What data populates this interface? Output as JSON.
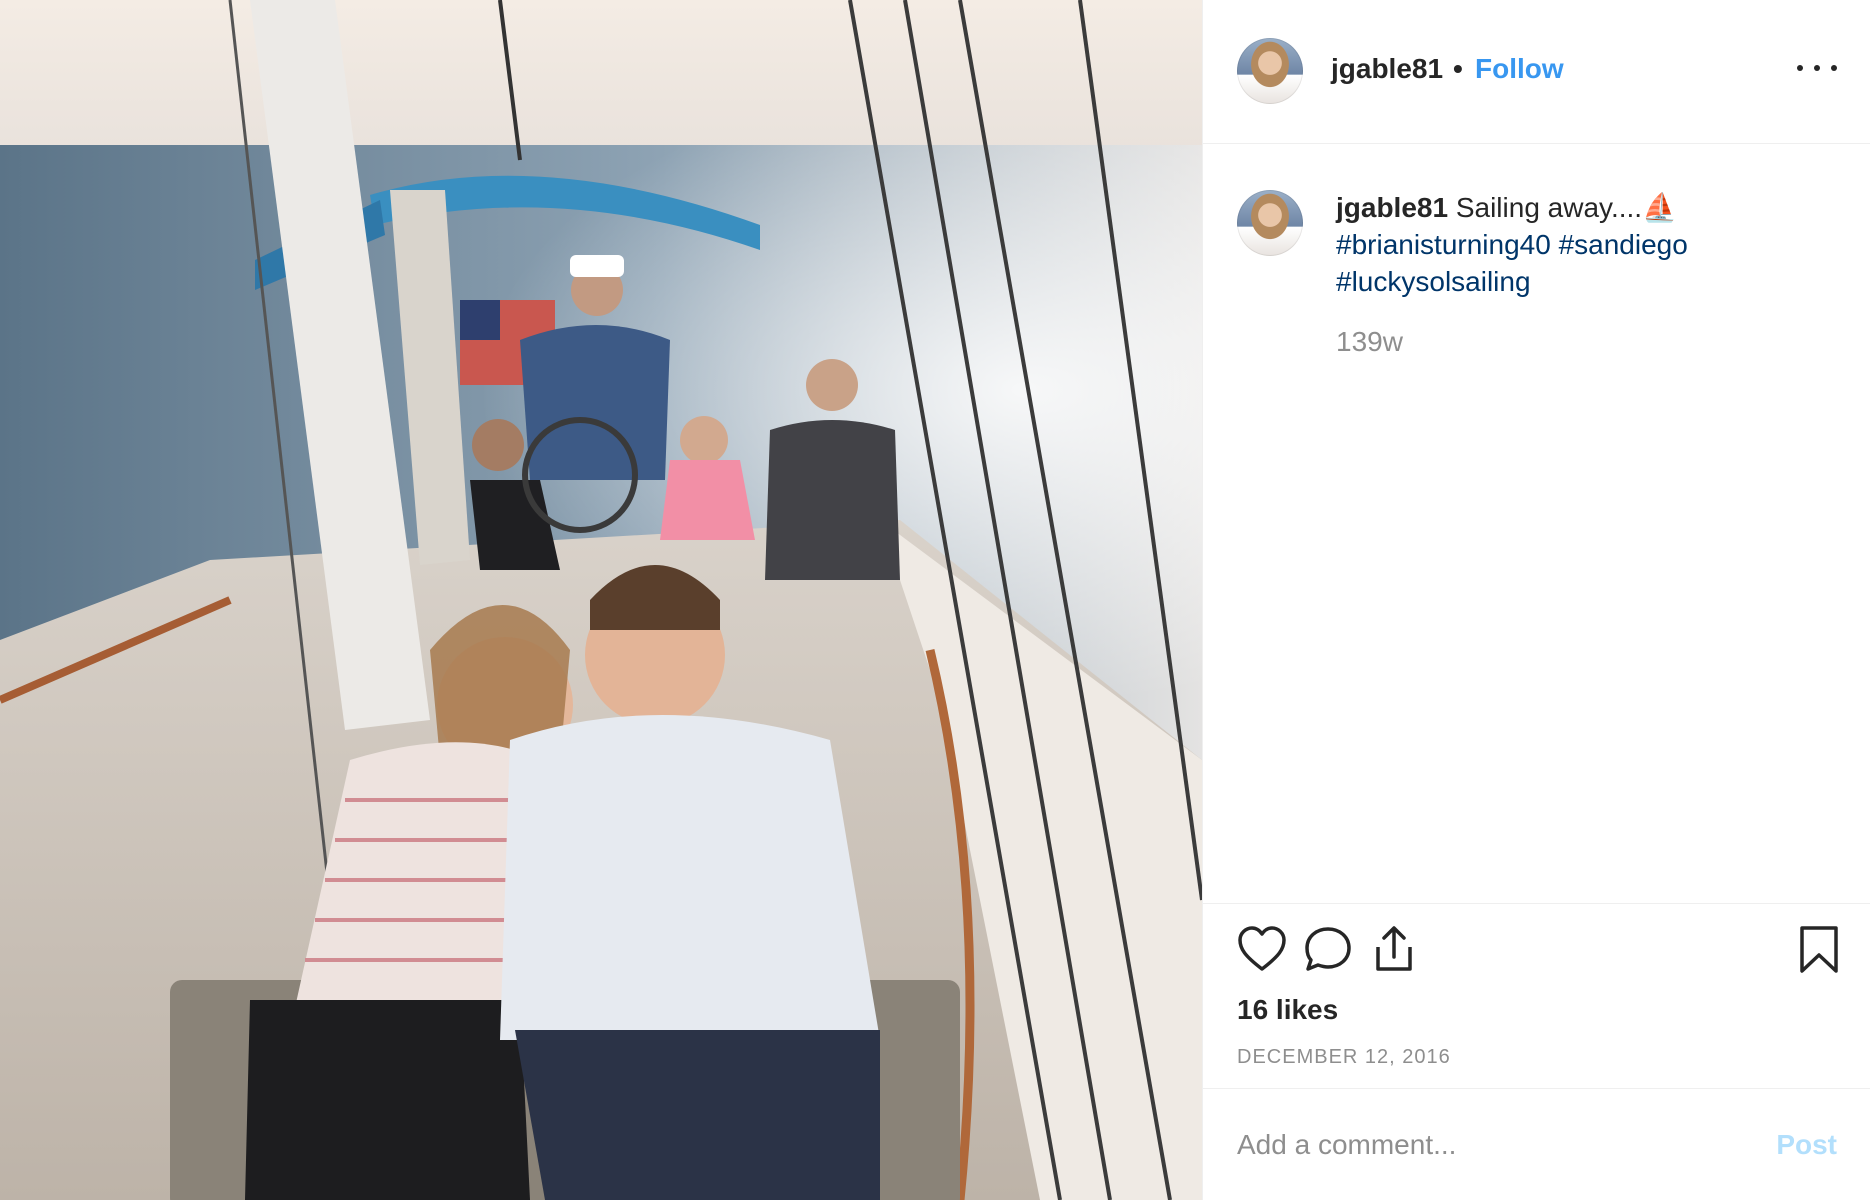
{
  "post": {
    "username": "jgable81",
    "separator": "•",
    "follow_label": "Follow",
    "more_icon": "more-options-icon",
    "caption_text": " Sailing away....",
    "caption_emoji": "⛵",
    "hashtags": [
      "#brianisturning40",
      "#sandiego",
      "#luckysolsailing"
    ],
    "caption_age": "139w",
    "likes": "16 likes",
    "date": "DECEMBER 12, 2016"
  },
  "actions": {
    "like_icon": "heart-icon",
    "comment_icon": "comment-icon",
    "share_icon": "share-icon",
    "save_icon": "bookmark-icon"
  },
  "comment": {
    "placeholder": "Add a comment...",
    "post_label": "Post"
  },
  "colors": {
    "link_blue": "#3897f0",
    "hashtag_blue": "#003569",
    "muted_gray": "#8e8e8e",
    "post_disabled": "#b2dffc"
  }
}
